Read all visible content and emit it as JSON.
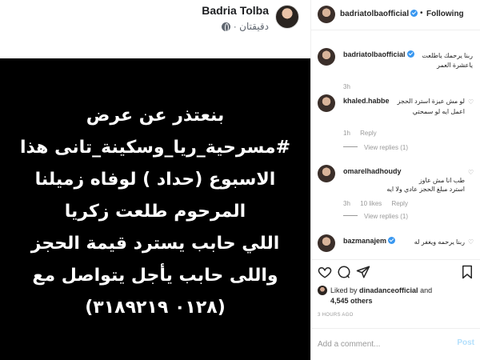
{
  "facebook_post": {
    "author_name": "Badria Tolba",
    "time_label": "دقيقتان ·",
    "privacy_icon": "globe-icon",
    "image_text_lines": [
      "بنعتذر عن عرض",
      "#مسرحية_ريا_وسكينة_تانى هذا",
      "الاسبوع (حداد ) لوفاه زميلنا",
      "المرحوم طلعت زكريا",
      "اللي حابب يسترد قيمة الحجز",
      "واللى حابب يأجل يتواصل مع",
      "(٠١٢٨ ٣١٨٩٢١٩)"
    ]
  },
  "instagram": {
    "header": {
      "username": "badriatolbaofficial",
      "separator": "•",
      "follow_state": "Following"
    },
    "comments": [
      {
        "username": "badriatolbaofficial",
        "text_lines": [
          "ربنا يرحمك ياطلعت",
          "ياعشرة العمر"
        ],
        "time": "3h",
        "likes": "",
        "reply": "",
        "view_replies": ""
      },
      {
        "username": "khaled.habbe",
        "text_lines": [
          "لو مش عيزة استرد الحجز",
          "اعمل ايه لو سمحتي"
        ],
        "time": "1h",
        "likes": "",
        "reply": "Reply",
        "view_replies": "View replies (1)"
      },
      {
        "username": "omarelhadhoudy",
        "text_lines": [
          "طب انا مش عاوز",
          "استرد مبلغ الحجز عادي ولا ايه"
        ],
        "time": "3h",
        "likes": "10 likes",
        "reply": "Reply",
        "view_replies": "View replies (1)"
      },
      {
        "username": "bazmanajem",
        "text_lines": [
          "ربنا يرحمه ويغفر له"
        ],
        "time": "",
        "likes": "",
        "reply": "",
        "view_replies": ""
      }
    ],
    "likes": {
      "prefix": "Liked by ",
      "liker": "dinadanceofficial",
      "connector": " and",
      "count_line": "4,545 others"
    },
    "timestamp": "3 HOURS AGO",
    "add_comment": {
      "placeholder": "Add a comment...",
      "post_label": "Post"
    },
    "colors": {
      "verified": "#3897f0",
      "post_disabled": "#b2dffc",
      "muted": "#999999"
    }
  }
}
